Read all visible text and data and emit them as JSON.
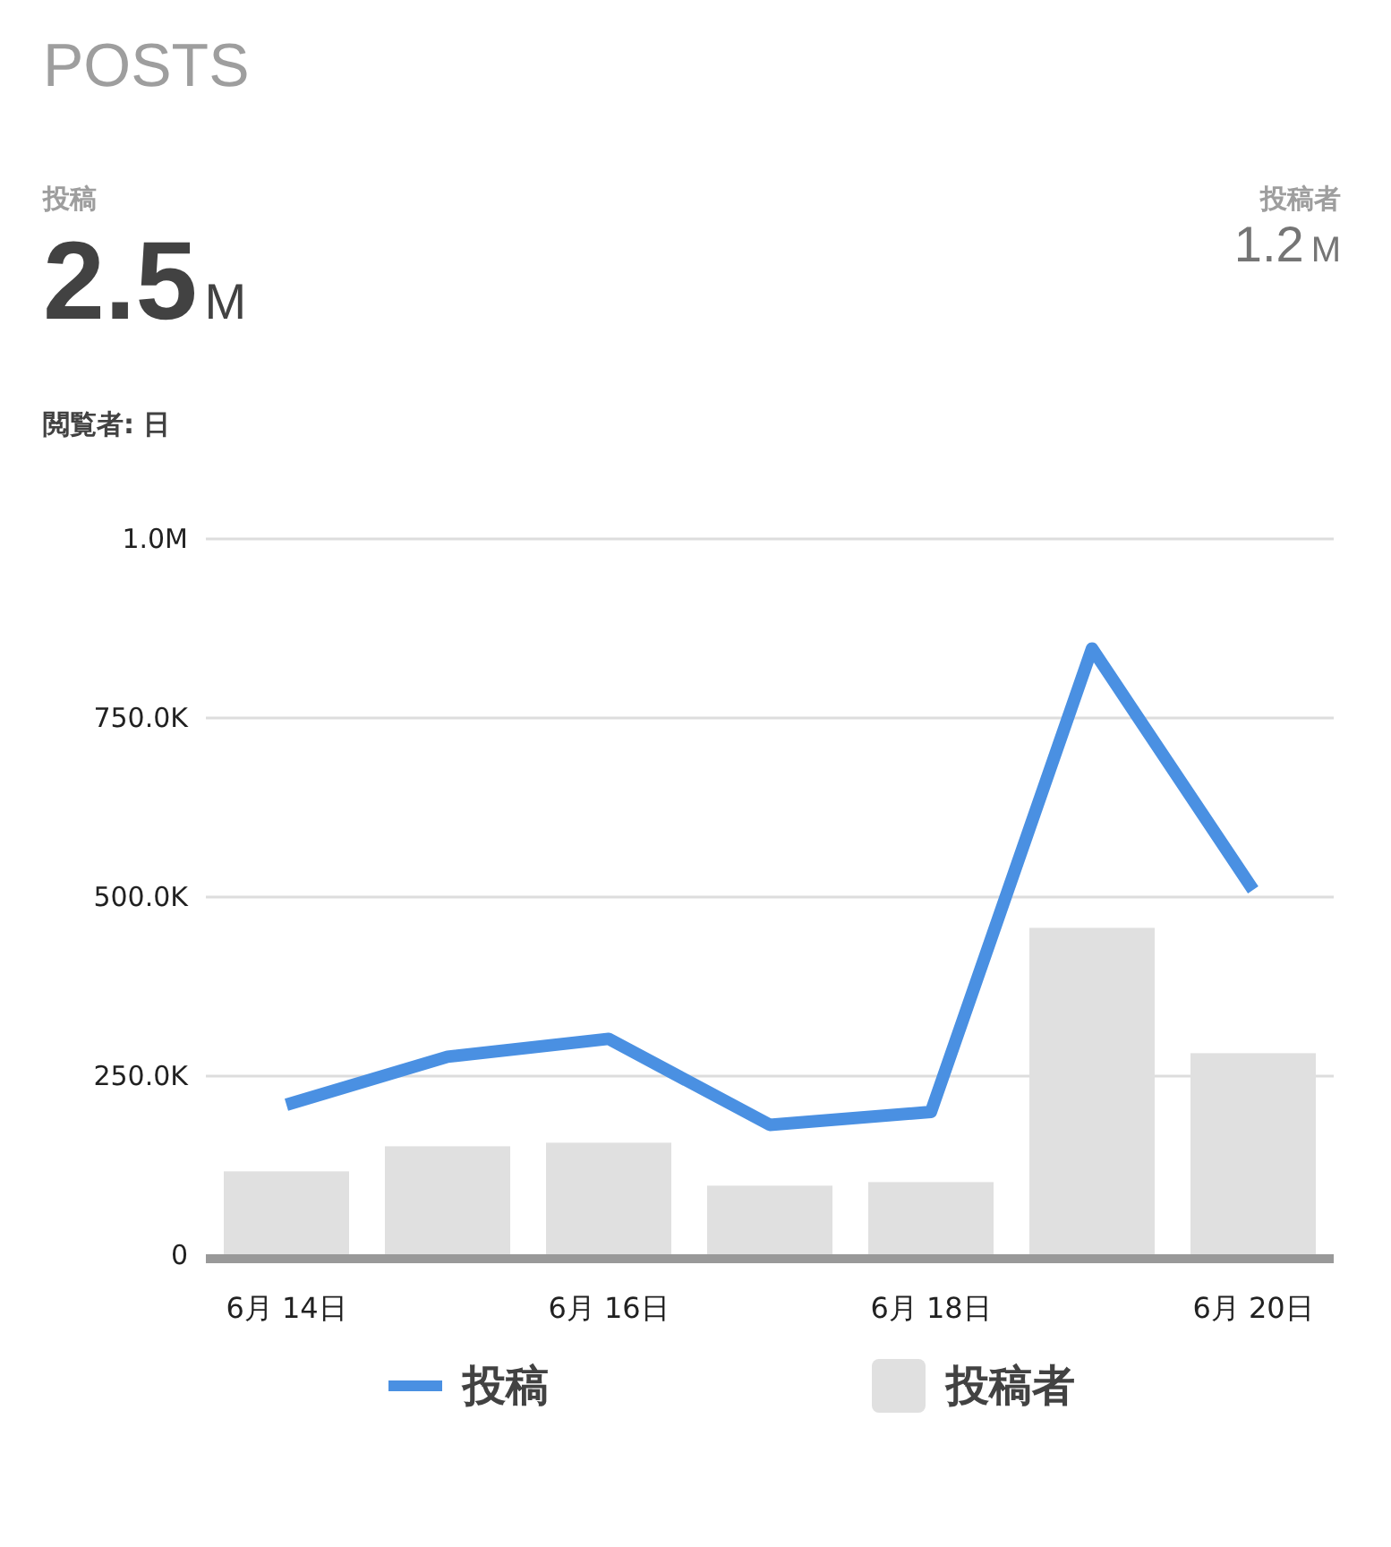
{
  "title": "POSTS",
  "metrics": [
    {
      "label": "投稿",
      "value": "2.5",
      "unit": "M"
    },
    {
      "label": "投稿者",
      "value": "1.2",
      "unit": "M"
    }
  ],
  "filter": {
    "label": "閲覧者: 日"
  },
  "chart_data": {
    "type": "bar",
    "stacked": false,
    "grid": true,
    "categories": [
      "6月 14日",
      null,
      "6月 16日",
      null,
      "6月 18日",
      null,
      "6月 20日"
    ],
    "series": [
      {
        "name": "投稿",
        "type": "line",
        "color": "#4a90e2",
        "values": [
          210000,
          277000,
          302000,
          182000,
          200000,
          847000,
          510000
        ]
      },
      {
        "name": "投稿者",
        "type": "bar",
        "color": "#e0e0e0",
        "values": [
          117000,
          152000,
          157000,
          97000,
          102000,
          457000,
          282000
        ]
      }
    ],
    "ylim": [
      0,
      1000000
    ],
    "yticks": [
      {
        "value": 0,
        "label": "0"
      },
      {
        "value": 250000,
        "label": "250.0K"
      },
      {
        "value": 500000,
        "label": "500.0K"
      },
      {
        "value": 750000,
        "label": "750.0K"
      },
      {
        "value": 1000000,
        "label": "1.0M"
      }
    ]
  }
}
